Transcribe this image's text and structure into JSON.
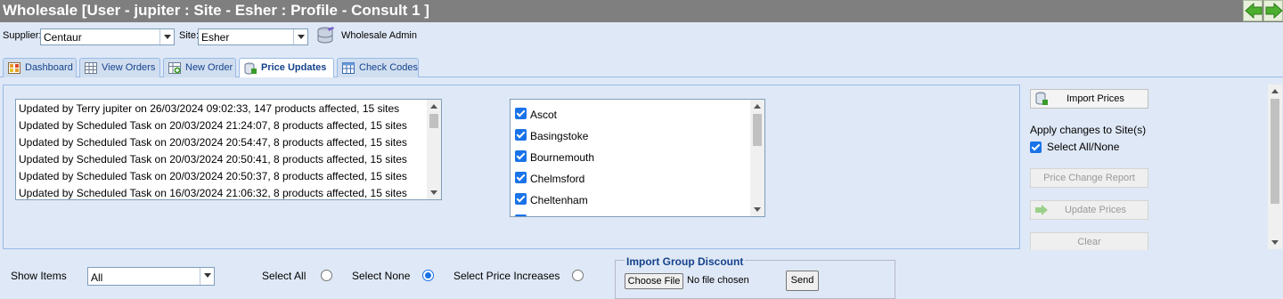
{
  "window": {
    "title": "Wholesale [User - jupiter : Site - Esher : Profile - Consult 1 ]"
  },
  "toolbar": {
    "supplier_label": "Supplier:",
    "supplier_value": "Centaur",
    "site_label": "Site:",
    "site_value": "Esher",
    "admin_label": "Wholesale Admin"
  },
  "tabs": [
    {
      "label": "Dashboard",
      "icon": "dashboard-icon"
    },
    {
      "label": "View Orders",
      "icon": "grid-icon"
    },
    {
      "label": "New Order",
      "icon": "add-grid-icon"
    },
    {
      "label": "Price Updates",
      "icon": "database-edit-icon",
      "active": true
    },
    {
      "label": "Check Codes",
      "icon": "table-icon"
    }
  ],
  "updates": [
    "Updated by Terry jupiter on 26/03/2024 09:02:33, 147 products affected, 15 sites",
    "Updated by Scheduled Task on 20/03/2024 21:24:07, 8 products affected, 15 sites",
    "Updated by Scheduled Task on 20/03/2024 20:54:47, 8 products affected, 15 sites",
    "Updated by Scheduled Task on 20/03/2024 20:50:41, 8 products affected, 15 sites",
    "Updated by Scheduled Task on 20/03/2024 20:50:37, 8 products affected, 15 sites",
    "Updated by Scheduled Task on 16/03/2024 21:06:32, 8 products affected, 15 sites"
  ],
  "sites": [
    {
      "name": "Ascot",
      "checked": true
    },
    {
      "name": "Basingstoke",
      "checked": true
    },
    {
      "name": "Bournemouth",
      "checked": true
    },
    {
      "name": "Chelmsford",
      "checked": true
    },
    {
      "name": "Cheltenham",
      "checked": true
    }
  ],
  "actions": {
    "import_prices": "Import Prices",
    "apply_changes": "Apply changes to Site(s)",
    "select_all_none": "Select All/None",
    "price_change_report": "Price Change Report",
    "update_prices": "Update Prices",
    "clear": "Clear"
  },
  "filters": {
    "show_items_label": "Show Items",
    "show_items_value": "All",
    "select_all": "Select All",
    "select_none": "Select None",
    "select_price_increases": "Select Price Increases",
    "selected": "Select None"
  },
  "import_group": {
    "legend": "Import Group Discount",
    "choose_file": "Choose File",
    "file_status": "No file chosen",
    "send": "Send"
  },
  "colors": {
    "title_bar": "#7f7f7f",
    "panel_bg": "#dfe8f6",
    "accent": "#15428b",
    "checkbox": "#1a73e8"
  }
}
